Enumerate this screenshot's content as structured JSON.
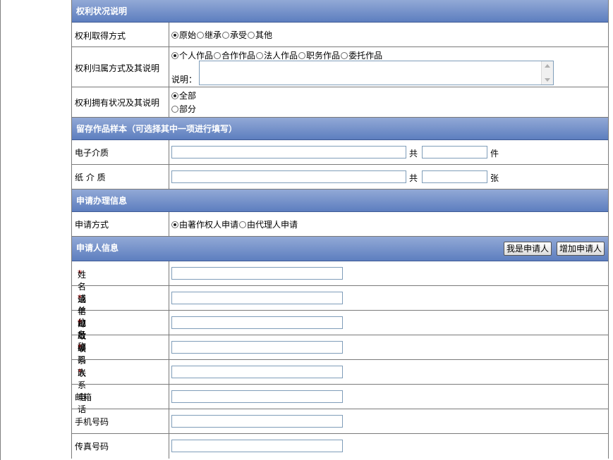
{
  "rights": {
    "title": "权利状况说明",
    "acquire": {
      "label": "权利取得方式",
      "options": [
        "原始",
        "继承",
        "承受",
        "其他"
      ],
      "selected": "原始"
    },
    "ownership": {
      "label": "权利归属方式及其说明",
      "options": [
        "个人作品",
        "合作作品",
        "法人作品",
        "职务作品",
        "委托作品"
      ],
      "selected": "个人作品",
      "note_label": "说明："
    },
    "holding": {
      "label": "权利拥有状况及其说明",
      "options": [
        "全部",
        "部分"
      ],
      "selected": "全部"
    }
  },
  "sample": {
    "title": "留存作品样本（可选择其中一项进行填写）",
    "electronic": {
      "label": "电子介质",
      "total": "共",
      "unit": "件"
    },
    "paper": {
      "label": "纸 介 质",
      "total": "共",
      "unit": "张"
    }
  },
  "handling": {
    "title": "申请办理信息",
    "method": {
      "label": "申请方式",
      "options": [
        "由著作权人申请",
        "由代理人申请"
      ],
      "selected": "由著作权人申请"
    }
  },
  "applicant": {
    "title": "申请人信息",
    "btn_me": "我是申请人",
    "btn_add": "增加申请人",
    "required_mark": "*",
    "fields": [
      {
        "label": "姓名或单位名称",
        "required": true
      },
      {
        "label": "通信地址",
        "required": true
      },
      {
        "label": "邮政编码",
        "required": true
      },
      {
        "label": "联系人",
        "required": true
      },
      {
        "label": "联系电话",
        "required": true
      },
      {
        "label": "邮箱",
        "required": false
      },
      {
        "label": "手机号码",
        "required": false
      },
      {
        "label": "传真号码",
        "required": false
      }
    ]
  },
  "colors": {
    "header_top": "#92a9d6",
    "header_bottom": "#5d7ebf",
    "required": "#cc0000"
  }
}
